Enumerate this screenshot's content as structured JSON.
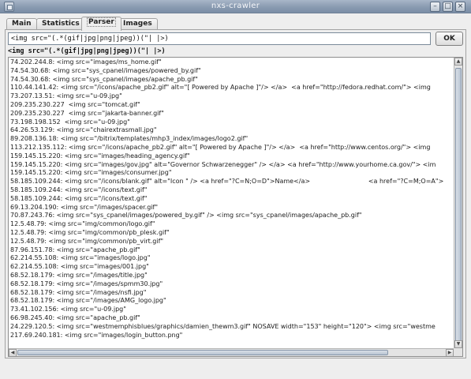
{
  "window": {
    "title": "nxs-crawler",
    "minimize_glyph": "–",
    "maximize_glyph": "□",
    "close_glyph": "×"
  },
  "tabs": [
    {
      "label": "Main",
      "active": false
    },
    {
      "label": "Statistics",
      "active": false
    },
    {
      "label": "Parser",
      "active": true
    },
    {
      "label": "Images",
      "active": false
    }
  ],
  "parser": {
    "regex_value": "<img src=\"(.*(gif|jpg|png|jpeg))(\"| |>)",
    "ok_label": "OK",
    "pattern_label": "<img src=\"(.*(gif|jpg|png|jpeg))(\"| |>)",
    "results": [
      "74.202.244.8: <img src=\"images/ms_home.gif\"",
      "74.54.30.68: <img src=\"sys_cpanel/images/powered_by.gif\"",
      "74.54.30.68: <img src=\"sys_cpanel/images/apache_pb.gif\"",
      "110.44.141.42: <img src=\"/icons/apache_pb2.gif\" alt=\"[ Powered by Apache ]\"/> </a>  <a href=\"http://fedora.redhat.com/\"> <img",
      "73.207.13.51: <img src=\"u-09.jpg\"",
      "209.235.230.227  <img src=\"tomcat.gif\"",
      "209.235.230.227  <img src=\"jakarta-banner.gif\"",
      "73.198.198.152  <img src=\"u-09.jpg\"",
      "64.26.53.129: <img src=\"chairextrasmall.jpg\"",
      "89.208.136.18: <img src=\"/bitrix/templates/mhp3_index/images/logo2.gif\"",
      "113.212.135.112: <img src=\"/icons/apache_pb2.gif\" alt=\"[ Powered by Apache ]\"/> </a>  <a href=\"http://www.centos.org/\"> <img",
      "159.145.15.220: <img src=\"images/heading_agency.gif\"",
      "159.145.15.220: <img src=\"images/gov.jpg\" alt=\"Governor Schwarzenegger\" /> </a> <a href=\"http://www.yourhome.ca.gov/\"> <im",
      "159.145.15.220: <img src=\"images/consumer.jpg\"",
      "58.185.109.244: <img src=\"/icons/blank.gif\" alt=\"Icon \" /> <a href=\"?C=N;O=D\">Name</a>                             <a href=\"?C=M;O=A\">",
      "58.185.109.244: <img src=\"/icons/text.gif\"",
      "58.185.109.244: <img src=\"/icons/text.gif\"",
      "69.13.204.190: <img src=\"/images/spacer.gif\"",
      "70.87.243.76: <img src=\"sys_cpanel/images/powered_by.gif\" /> <img src=\"sys_cpanel/images/apache_pb.gif\"",
      "12.5.48.79: <img src=\"img/common/logo.gif\"",
      "12.5.48.79: <img src=\"img/common/pb_plesk.gif\"",
      "12.5.48.79: <img src=\"img/common/pb_virt.gif\"",
      "87.96.151.78: <img src=\"apache_pb.gif\"",
      "62.214.55.108: <img src=\"images/logo.jpg\"",
      "62.214.55.108: <img src=\"images/001.jpg\"",
      "68.52.18.179: <img src=\"/images/title.jpg\"",
      "68.52.18.179: <img src=\"/images/spmm30.jpg\"",
      "68.52.18.179: <img src=\"/images/nsfi.jpg\"",
      "68.52.18.179: <img src=\"/images/AMG_logo.jpg\"",
      "73.41.102.156: <img src=\"u-09.jpg\"",
      "66.98.245.40: <img src=\"apache_pb.gif\"",
      "24.229.120.5: <img src=\"westmemphisblues/graphics/damien_thewm3.gif\" NOSAVE width=\"153\" height=\"120\"> <img src=\"westme",
      "217.69.240.181: <img src=\"images/login_button.png\""
    ]
  },
  "icons": {
    "app": "window-app-icon",
    "scroll_up": "▲",
    "scroll_down": "▼",
    "scroll_left": "◀",
    "scroll_right": "▶"
  },
  "colors": {
    "titlebar": "#8a9bb1",
    "background": "#eeeeee",
    "results_background": "#ffffff"
  }
}
